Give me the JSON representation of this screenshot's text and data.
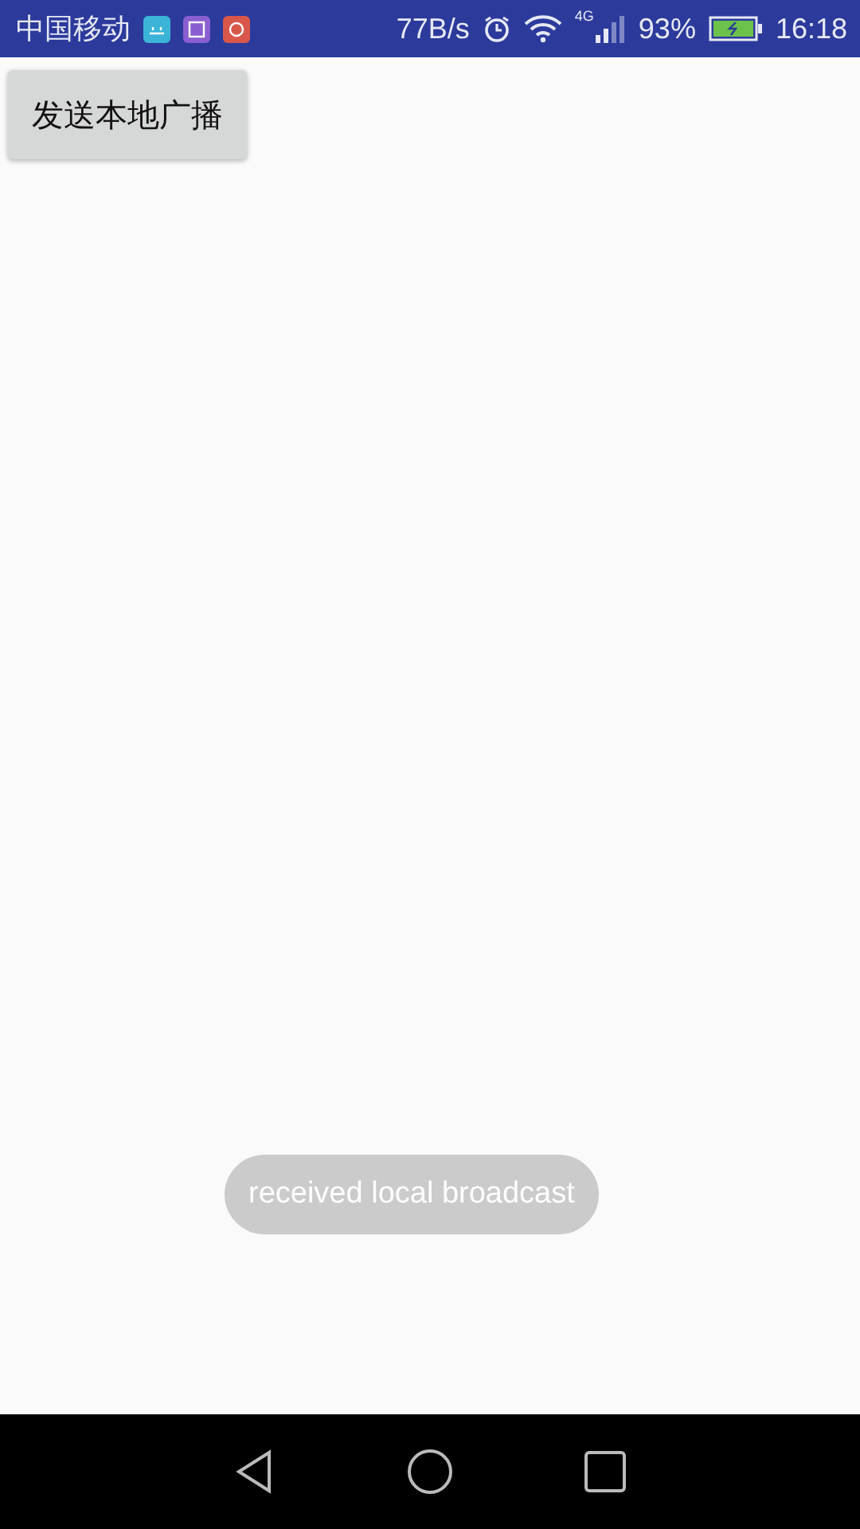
{
  "status_bar": {
    "carrier": "中国移动",
    "speed": "77B/s",
    "network": "4G",
    "battery": "93%",
    "time": "16:18"
  },
  "button": {
    "label": "发送本地广播"
  },
  "toast": {
    "text": "received local broadcast"
  }
}
